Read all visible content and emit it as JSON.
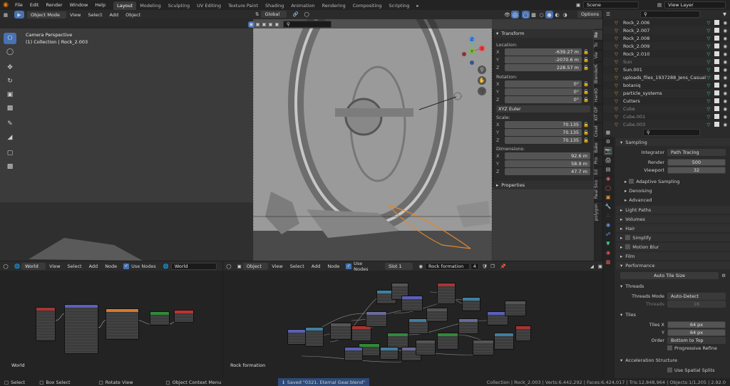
{
  "topbar": {
    "menus": [
      "File",
      "Edit",
      "Render",
      "Window",
      "Help"
    ],
    "workspaces": [
      "Layout",
      "Modeling",
      "Sculpting",
      "UV Editing",
      "Texture Paint",
      "Shading",
      "Animation",
      "Rendering",
      "Compositing",
      "Scripting"
    ],
    "active_workspace": "Layout",
    "scene": "Scene",
    "view_layer": "View Layer"
  },
  "viewport": {
    "mode": "Object Mode",
    "menus": [
      "View",
      "Select",
      "Add",
      "Object"
    ],
    "orientation": "Global",
    "options": "Options",
    "overlay_title": "Camera Perspective",
    "overlay_subtitle": "(1) Collection | Rock_2.003",
    "axis": {
      "x": "X",
      "y": "Y",
      "z": "Z"
    }
  },
  "npanel": {
    "transform_title": "Transform",
    "location_label": "Location:",
    "location": {
      "x": "-639.27 m",
      "y": "-2070.6 m",
      "z": "228.57 m"
    },
    "rotation_label": "Rotation:",
    "rotation": {
      "x": "0°",
      "y": "0°",
      "z": "0°"
    },
    "rotation_mode": "XYZ Euler",
    "scale_label": "Scale:",
    "scale": {
      "x": "70.135",
      "y": "70.135",
      "z": "70.135"
    },
    "dimensions_label": "Dimensions:",
    "dimensions": {
      "x": "92.6 m",
      "y": "58.9 m",
      "z": "47.7 m"
    },
    "properties_title": "Properties",
    "tabs": [
      "Ite",
      "To",
      "Vie",
      "BlenderK",
      "HardO",
      "KIT OP",
      "Creat",
      "Bake",
      "Pro",
      "Ed",
      "Real Sno",
      "polygon"
    ]
  },
  "outliner": {
    "rows": [
      {
        "name": "Rock_2.006",
        "dim": false
      },
      {
        "name": "Rock_2.007",
        "dim": false
      },
      {
        "name": "Rock_2.008",
        "dim": false
      },
      {
        "name": "Rock_2.009",
        "dim": false
      },
      {
        "name": "Rock_2.010",
        "dim": false
      },
      {
        "name": "Sun",
        "dim": true
      },
      {
        "name": "Sun.001",
        "dim": false
      },
      {
        "name": "uploads_files_1937288_Jens_Casual",
        "dim": false
      },
      {
        "name": "botaniq",
        "dim": false
      },
      {
        "name": "particle_systems",
        "dim": false
      },
      {
        "name": "Cutters",
        "dim": false
      },
      {
        "name": "Cube",
        "dim": true
      },
      {
        "name": "Cube.001",
        "dim": true
      },
      {
        "name": "Cube.003",
        "dim": true
      }
    ]
  },
  "properties": {
    "sampling": "Sampling",
    "integrator_label": "Integrator",
    "integrator": "Path Tracing",
    "render_label": "Render",
    "render_value": "500",
    "viewport_label": "Viewport",
    "viewport_value": "32",
    "adaptive": "Adaptive Sampling",
    "denoising": "Denoising",
    "advanced": "Advanced",
    "light_paths": "Light Paths",
    "volumes": "Volumes",
    "hair": "Hair",
    "simplify": "Simplify",
    "motion_blur": "Motion Blur",
    "film": "Film",
    "performance": "Performance",
    "auto_tile": "Auto Tile Size",
    "threads": "Threads",
    "threads_mode_label": "Threads Mode",
    "threads_mode": "Auto-Detect",
    "threads_label": "Threads",
    "threads_value": "16",
    "tiles": "Tiles",
    "tiles_x_label": "Tiles X",
    "tiles_x": "64 px",
    "tiles_y_label": "Y",
    "tiles_y": "64 px",
    "order_label": "Order",
    "order": "Bottom to Top",
    "progressive": "Progressive Refine",
    "accel": "Acceleration Structure",
    "spatial": "Use Spatial Splits"
  },
  "node_left": {
    "type": "World",
    "menus": [
      "View",
      "Select",
      "Add",
      "Node"
    ],
    "use_nodes": "Use Nodes",
    "world_name": "World",
    "footer": "World"
  },
  "node_right": {
    "type": "Object",
    "menus": [
      "View",
      "Select",
      "Add",
      "Node"
    ],
    "use_nodes": "Use Nodes",
    "slot": "Slot 1",
    "material": "Rock formation",
    "users": "4",
    "footer": "Rock formation"
  },
  "status": {
    "select": "Select",
    "box_select": "Box Select",
    "rotate": "Rotate View",
    "context": "Object Context Menu",
    "saved": "Saved \"0321. Eternal Gear.blend\"",
    "stats": "Collection | Rock_2.003 | Verts:6,442,292 | Faces:6,424,017 | Tris:12,848,964 | Objects:1/1,205 | 2.92.0"
  },
  "colors": {
    "accent": "#4772b3",
    "selection": "#e0882c"
  }
}
